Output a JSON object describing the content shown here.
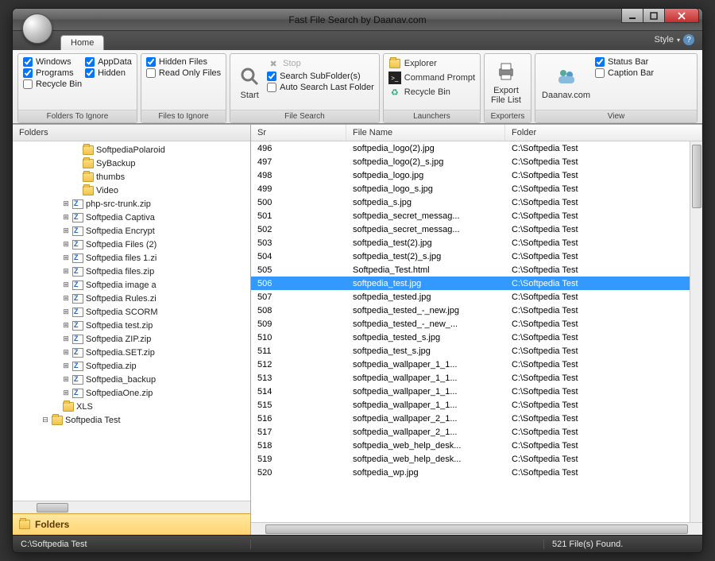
{
  "title": "Fast File Search by Daanav.com",
  "style_label": "Style",
  "tabs": {
    "home": "Home"
  },
  "ribbon": {
    "folders_to_ignore": {
      "title": "Folders To Ignore",
      "windows": "Windows",
      "programs": "Programs",
      "recycle_bin": "Recycle Bin",
      "appdata": "AppData",
      "hidden": "Hidden"
    },
    "files_to_ignore": {
      "title": "Files to Ignore",
      "hidden_files": "Hidden Files",
      "read_only": "Read Only Files"
    },
    "file_search": {
      "title": "File Search",
      "start": "Start",
      "stop": "Stop",
      "search_subfolders": "Search SubFolder(s)",
      "auto_search": "Auto Search Last Folder"
    },
    "launchers": {
      "title": "Launchers",
      "explorer": "Explorer",
      "cmd": "Command Prompt",
      "recycle": "Recycle Bin"
    },
    "exporters": {
      "title": "Exporters",
      "export": "Export\nFile List"
    },
    "view": {
      "title": "View",
      "link": "Daanav.com",
      "status_bar": "Status Bar",
      "caption_bar": "Caption Bar"
    }
  },
  "folders_panel": {
    "header": "Folders",
    "footer": "Folders",
    "tree": [
      {
        "indent": 75,
        "toggle": "",
        "icon": "folder",
        "label": "SoftpediaPolaroid"
      },
      {
        "indent": 75,
        "toggle": "",
        "icon": "folder",
        "label": "SyBackup"
      },
      {
        "indent": 75,
        "toggle": "",
        "icon": "folder",
        "label": "thumbs"
      },
      {
        "indent": 75,
        "toggle": "",
        "icon": "folder",
        "label": "Video"
      },
      {
        "indent": 62,
        "toggle": "+",
        "icon": "zip",
        "label": "php-src-trunk.zip"
      },
      {
        "indent": 62,
        "toggle": "+",
        "icon": "zip",
        "label": "Softpedia Captiva"
      },
      {
        "indent": 62,
        "toggle": "+",
        "icon": "zip",
        "label": "Softpedia Encrypt"
      },
      {
        "indent": 62,
        "toggle": "+",
        "icon": "zip",
        "label": "Softpedia Files (2)"
      },
      {
        "indent": 62,
        "toggle": "+",
        "icon": "zip",
        "label": "Softpedia files 1.zi"
      },
      {
        "indent": 62,
        "toggle": "+",
        "icon": "zip",
        "label": "Softpedia files.zip"
      },
      {
        "indent": 62,
        "toggle": "+",
        "icon": "zip",
        "label": "Softpedia image a"
      },
      {
        "indent": 62,
        "toggle": "+",
        "icon": "zip",
        "label": "Softpedia Rules.zi"
      },
      {
        "indent": 62,
        "toggle": "+",
        "icon": "zip",
        "label": "Softpedia SCORM"
      },
      {
        "indent": 62,
        "toggle": "+",
        "icon": "zip",
        "label": "Softpedia test.zip"
      },
      {
        "indent": 62,
        "toggle": "+",
        "icon": "zip",
        "label": "Softpedia ZIP.zip"
      },
      {
        "indent": 62,
        "toggle": "+",
        "icon": "zip",
        "label": "Softpedia.SET.zip"
      },
      {
        "indent": 62,
        "toggle": "+",
        "icon": "zip",
        "label": "Softpedia.zip"
      },
      {
        "indent": 62,
        "toggle": "+",
        "icon": "zip",
        "label": "Softpedia_backup"
      },
      {
        "indent": 62,
        "toggle": "+",
        "icon": "zip",
        "label": "SoftpediaOne.zip"
      },
      {
        "indent": 50,
        "toggle": "",
        "icon": "folder",
        "label": "XLS"
      },
      {
        "indent": 36,
        "toggle": "-",
        "icon": "folder",
        "label": "Softpedia Test"
      }
    ]
  },
  "table": {
    "columns": {
      "sr": "Sr",
      "file_name": "File Name",
      "folder": "Folder"
    },
    "selected_sr": 506,
    "rows": [
      {
        "sr": 496,
        "fn": "softpedia_logo(2).jpg",
        "fd": "C:\\Softpedia Test"
      },
      {
        "sr": 497,
        "fn": "softpedia_logo(2)_s.jpg",
        "fd": "C:\\Softpedia Test"
      },
      {
        "sr": 498,
        "fn": "softpedia_logo.jpg",
        "fd": "C:\\Softpedia Test"
      },
      {
        "sr": 499,
        "fn": "softpedia_logo_s.jpg",
        "fd": "C:\\Softpedia Test"
      },
      {
        "sr": 500,
        "fn": "softpedia_s.jpg",
        "fd": "C:\\Softpedia Test"
      },
      {
        "sr": 501,
        "fn": "softpedia_secret_messag...",
        "fd": "C:\\Softpedia Test"
      },
      {
        "sr": 502,
        "fn": "softpedia_secret_messag...",
        "fd": "C:\\Softpedia Test"
      },
      {
        "sr": 503,
        "fn": "softpedia_test(2).jpg",
        "fd": "C:\\Softpedia Test"
      },
      {
        "sr": 504,
        "fn": "softpedia_test(2)_s.jpg",
        "fd": "C:\\Softpedia Test"
      },
      {
        "sr": 505,
        "fn": "Softpedia_Test.html",
        "fd": "C:\\Softpedia Test"
      },
      {
        "sr": 506,
        "fn": "softpedia_test.jpg",
        "fd": "C:\\Softpedia Test"
      },
      {
        "sr": 507,
        "fn": "softpedia_tested.jpg",
        "fd": "C:\\Softpedia Test"
      },
      {
        "sr": 508,
        "fn": "softpedia_tested_-_new.jpg",
        "fd": "C:\\Softpedia Test"
      },
      {
        "sr": 509,
        "fn": "softpedia_tested_-_new_...",
        "fd": "C:\\Softpedia Test"
      },
      {
        "sr": 510,
        "fn": "softpedia_tested_s.jpg",
        "fd": "C:\\Softpedia Test"
      },
      {
        "sr": 511,
        "fn": "softpedia_test_s.jpg",
        "fd": "C:\\Softpedia Test"
      },
      {
        "sr": 512,
        "fn": "softpedia_wallpaper_1_1...",
        "fd": "C:\\Softpedia Test"
      },
      {
        "sr": 513,
        "fn": "softpedia_wallpaper_1_1...",
        "fd": "C:\\Softpedia Test"
      },
      {
        "sr": 514,
        "fn": "softpedia_wallpaper_1_1...",
        "fd": "C:\\Softpedia Test"
      },
      {
        "sr": 515,
        "fn": "softpedia_wallpaper_1_1...",
        "fd": "C:\\Softpedia Test"
      },
      {
        "sr": 516,
        "fn": "softpedia_wallpaper_2_1...",
        "fd": "C:\\Softpedia Test"
      },
      {
        "sr": 517,
        "fn": "softpedia_wallpaper_2_1...",
        "fd": "C:\\Softpedia Test"
      },
      {
        "sr": 518,
        "fn": "softpedia_web_help_desk...",
        "fd": "C:\\Softpedia Test"
      },
      {
        "sr": 519,
        "fn": "softpedia_web_help_desk...",
        "fd": "C:\\Softpedia Test"
      },
      {
        "sr": 520,
        "fn": "softpedia_wp.jpg",
        "fd": "C:\\Softpedia Test"
      }
    ]
  },
  "status": {
    "path": "C:\\Softpedia Test",
    "count": "521 File(s) Found."
  }
}
